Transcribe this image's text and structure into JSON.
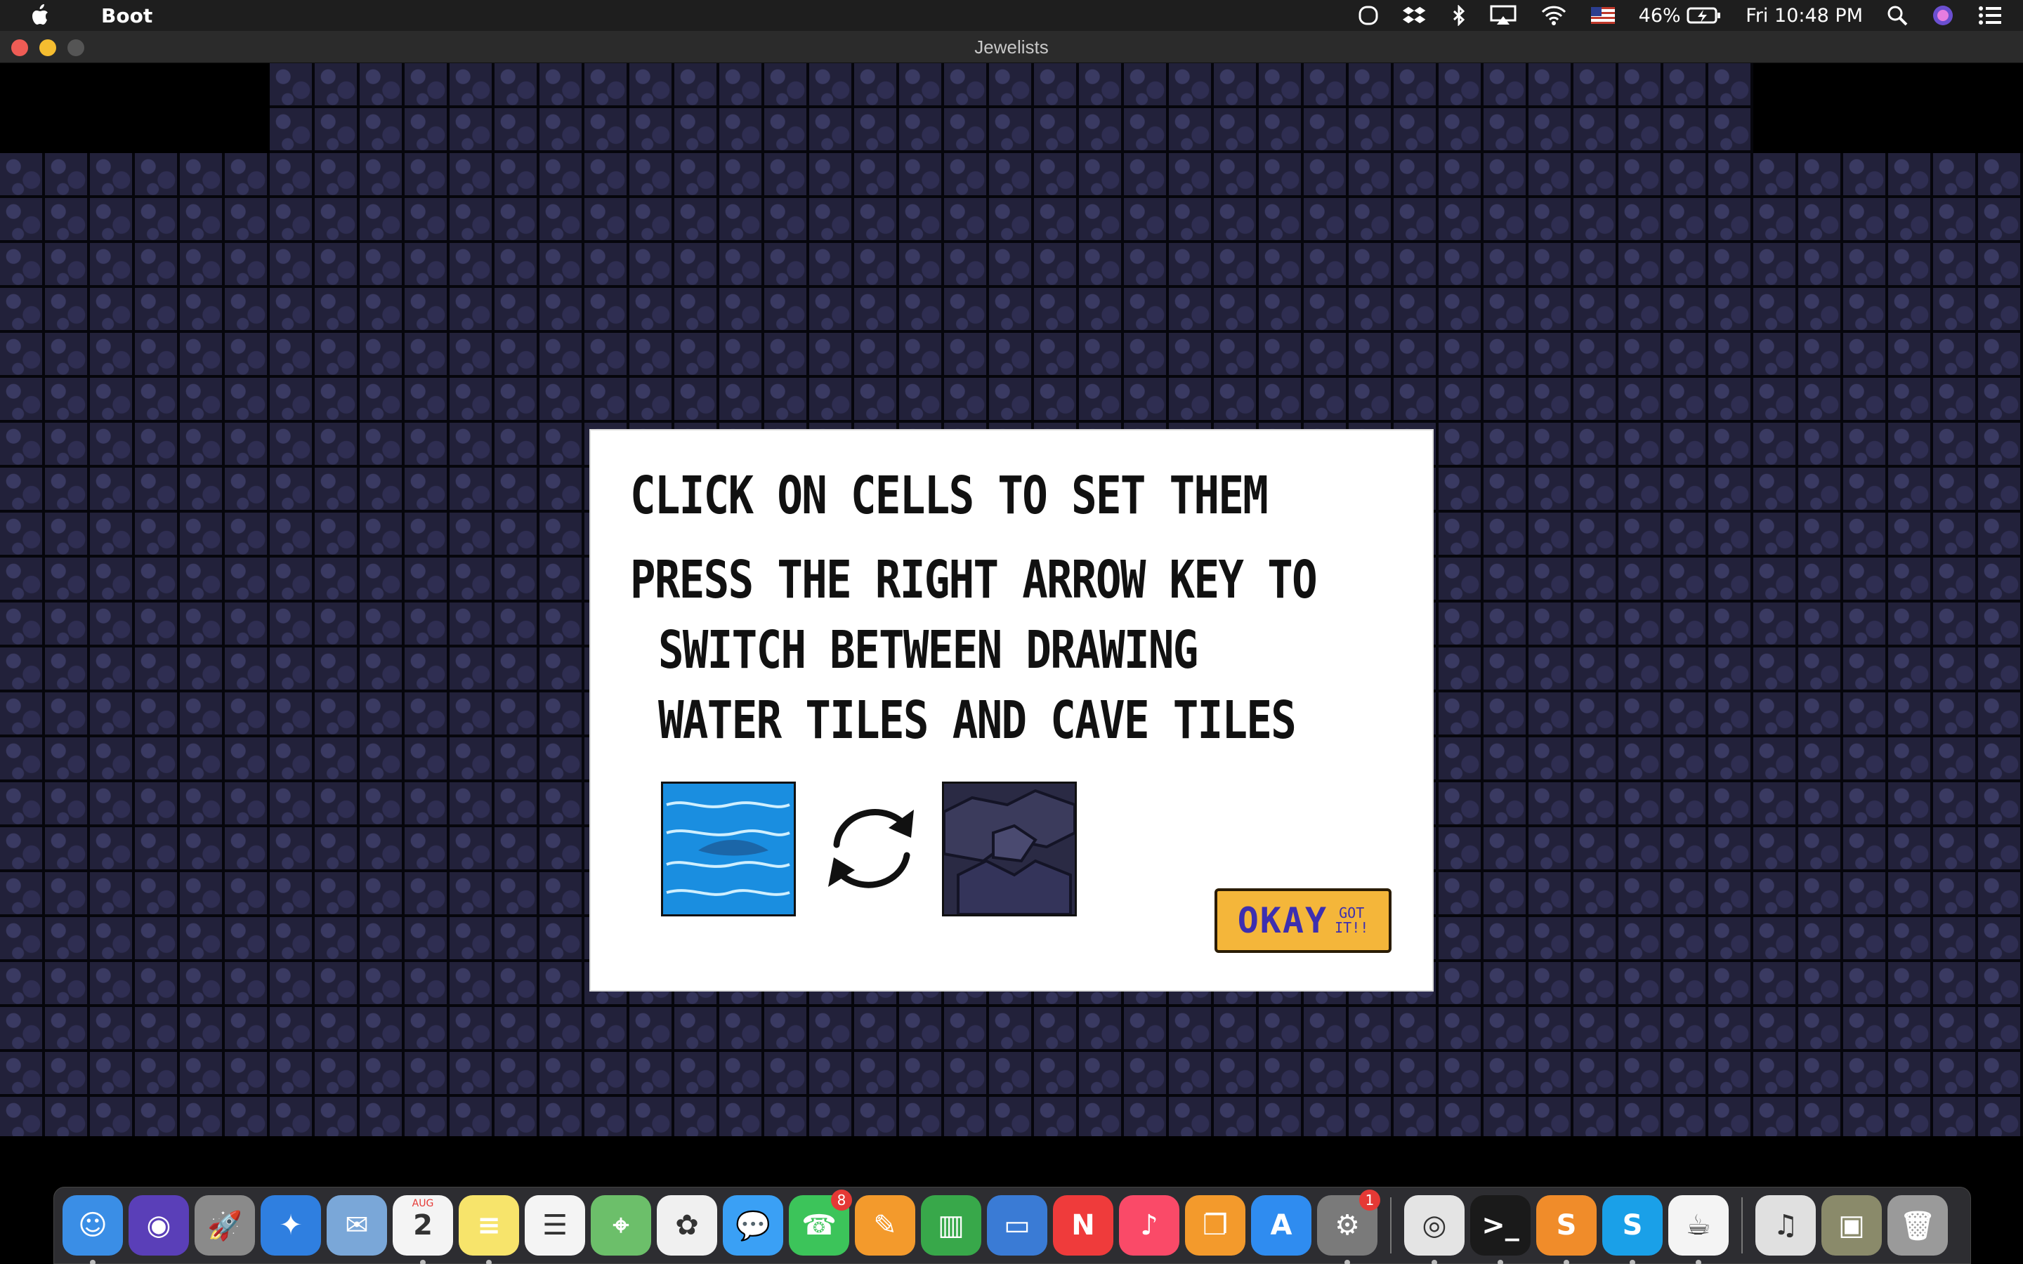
{
  "menubar": {
    "app_name": "Boot",
    "battery": "46%",
    "clock": "Fri 10:48 PM"
  },
  "window": {
    "title": "Jewelists"
  },
  "dialog": {
    "line1": "CLICK ON CELLS TO SET THEM",
    "line2": "PRESS THE RIGHT ARROW KEY TO",
    "line3": "SWITCH BETWEEN DRAWING",
    "line4": "WATER TILES AND CAVE TILES",
    "okay_main": "OKAY",
    "okay_sub_1": "GOT",
    "okay_sub_2": "IT!!"
  },
  "colors": {
    "water": "#1a8ee0",
    "cave": "#2a2a44",
    "button": "#f4b63a",
    "button_text": "#3d2fb0"
  },
  "dock": {
    "items": [
      {
        "name": "finder",
        "glyph": "☺",
        "color": "#3a8ee6",
        "running": true
      },
      {
        "name": "siri",
        "glyph": "◉",
        "color": "#5a3fb8",
        "running": false
      },
      {
        "name": "launchpad",
        "glyph": "🚀",
        "color": "#8a8a8a",
        "running": false
      },
      {
        "name": "safari",
        "glyph": "✦",
        "color": "#2f7fe0",
        "running": false
      },
      {
        "name": "mail-app",
        "glyph": "✉",
        "color": "#7aa7d8",
        "running": false
      },
      {
        "name": "calendar",
        "glyph": "2",
        "color": "#f4f4f4",
        "running": true,
        "label_month": "AUG"
      },
      {
        "name": "notes",
        "glyph": "≡",
        "color": "#f7e46b",
        "running": true
      },
      {
        "name": "reminders",
        "glyph": "☰",
        "color": "#f4f4f4",
        "running": false
      },
      {
        "name": "maps",
        "glyph": "⌖",
        "color": "#6cbf6a",
        "running": false
      },
      {
        "name": "photos",
        "glyph": "✿",
        "color": "#f0f0f0",
        "running": false
      },
      {
        "name": "messages",
        "glyph": "💬",
        "color": "#3aa0f5",
        "running": false
      },
      {
        "name": "facetime",
        "glyph": "☎",
        "color": "#3cc45a",
        "running": false,
        "badge": "8"
      },
      {
        "name": "pages",
        "glyph": "✎",
        "color": "#f39a2c",
        "running": false
      },
      {
        "name": "numbers",
        "glyph": "▥",
        "color": "#38a84a",
        "running": false
      },
      {
        "name": "keynote",
        "glyph": "▭",
        "color": "#3a7bd5",
        "running": false
      },
      {
        "name": "news",
        "glyph": "N",
        "color": "#ef3b3b",
        "running": false
      },
      {
        "name": "music",
        "glyph": "♪",
        "color": "#fa4a68",
        "running": false
      },
      {
        "name": "books",
        "glyph": "❐",
        "color": "#f39a2c",
        "running": false
      },
      {
        "name": "app-store",
        "glyph": "A",
        "color": "#2f8cf0",
        "running": false
      },
      {
        "name": "system-preferences",
        "glyph": "⚙",
        "color": "#7a7a7a",
        "running": true,
        "badge": "1"
      },
      {
        "name": "sep",
        "glyph": "",
        "color": "",
        "running": false
      },
      {
        "name": "chrome",
        "glyph": "◎",
        "color": "#e4e4e4",
        "running": true
      },
      {
        "name": "terminal",
        "glyph": ">_",
        "color": "#1a1a1a",
        "running": true
      },
      {
        "name": "sublime-text",
        "glyph": "S",
        "color": "#f08c2a",
        "running": true
      },
      {
        "name": "skype",
        "glyph": "S",
        "color": "#1aa0e8",
        "running": true
      },
      {
        "name": "java",
        "glyph": "☕",
        "color": "#f4f4f4",
        "running": true
      },
      {
        "name": "sep",
        "glyph": "",
        "color": "",
        "running": false
      },
      {
        "name": "music-file",
        "glyph": "♫",
        "color": "#e0e0e0",
        "running": false
      },
      {
        "name": "screenshot-stack",
        "glyph": "▣",
        "color": "#8a8a6a",
        "running": false
      },
      {
        "name": "trash",
        "glyph": "🗑",
        "color": "#9a9a9a",
        "running": false
      }
    ]
  }
}
